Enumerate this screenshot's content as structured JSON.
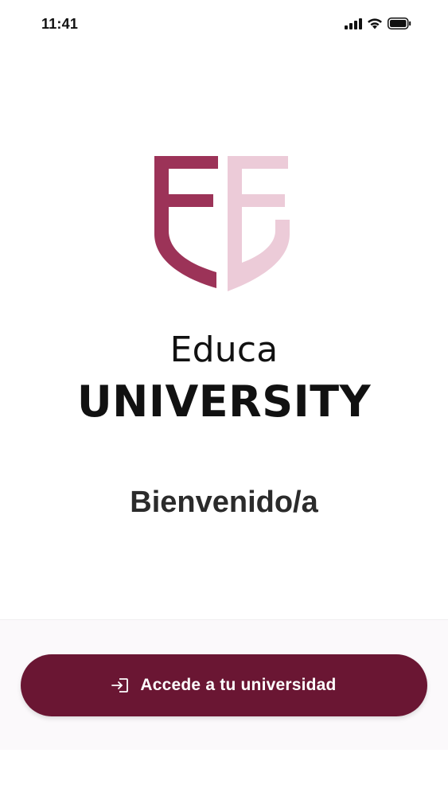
{
  "status_bar": {
    "time": "11:41",
    "icons": [
      "signal-icon",
      "wifi-icon",
      "battery-icon"
    ]
  },
  "logo": {
    "icon": "shield-ee-logo",
    "colors": {
      "dark": "#9c3358",
      "light": "#eccbd8"
    }
  },
  "brand": {
    "line1": "Educa",
    "line2": "UNIVERSITY"
  },
  "welcome": {
    "title": "Bienvenido/a"
  },
  "login": {
    "label": "Accede a tu universidad",
    "icon": "login-icon",
    "color": "#6a1633"
  }
}
